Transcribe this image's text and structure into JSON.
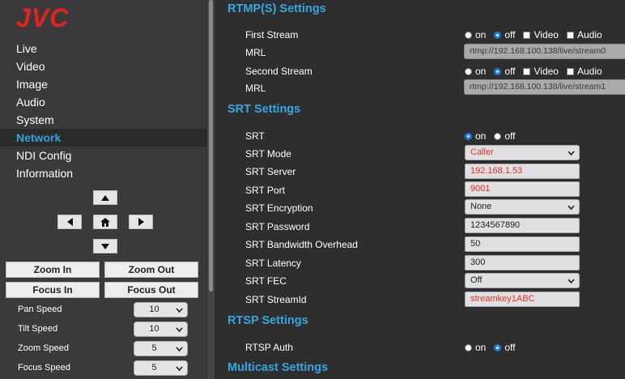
{
  "brand": {
    "logo_text": "JVC",
    "logo_color": "#e2231a"
  },
  "nav": {
    "items": [
      {
        "label": "Live"
      },
      {
        "label": "Video"
      },
      {
        "label": "Image"
      },
      {
        "label": "Audio"
      },
      {
        "label": "System"
      },
      {
        "label": "Network",
        "active": true
      },
      {
        "label": "NDI Config"
      },
      {
        "label": "Information"
      }
    ]
  },
  "ptz": {
    "icons": [
      "arrow-up-icon",
      "arrow-left-icon",
      "home-icon",
      "arrow-right-icon",
      "arrow-down-icon"
    ],
    "zoom_in": "Zoom In",
    "zoom_out": "Zoom Out",
    "focus_in": "Focus In",
    "focus_out": "Focus Out",
    "speeds": [
      {
        "label": "Pan Speed",
        "value": "10"
      },
      {
        "label": "Tilt Speed",
        "value": "10"
      },
      {
        "label": "Zoom Speed",
        "value": "5"
      },
      {
        "label": "Focus Speed",
        "value": "5"
      }
    ]
  },
  "rtmp": {
    "title": "RTMP(S) Settings",
    "first_stream_label": "First Stream",
    "first_stream_state": "off",
    "mrl_label": "MRL",
    "first_mrl": "rtmp://192.168.100.138/live/stream0",
    "second_stream_label": "Second Stream",
    "second_stream_state": "off",
    "second_mrl": "rtmp://192.168.100.138/live/stream1",
    "on": "on",
    "off": "off",
    "video": "Video",
    "audio": "Audio"
  },
  "srt": {
    "title": "SRT Settings",
    "srt_label": "SRT",
    "srt_state": "on",
    "mode_label": "SRT Mode",
    "mode_value": "Caller",
    "server_label": "SRT Server",
    "server_value": "192.168.1.53",
    "port_label": "SRT Port",
    "port_value": "9001",
    "encryption_label": "SRT Encryption",
    "encryption_value": "None",
    "password_label": "SRT Password",
    "password_value": "1234567890",
    "bandwidth_label": "SRT Bandwidth Overhead",
    "bandwidth_value": "50",
    "latency_label": "SRT Latency",
    "latency_value": "300",
    "fec_label": "SRT FEC",
    "fec_value": "Off",
    "streamid_label": "SRT StreamId",
    "streamid_value": "streamkey1ABC"
  },
  "rtsp": {
    "title": "RTSP Settings",
    "auth_label": "RTSP Auth",
    "auth_state": "off"
  },
  "multicast": {
    "title": "Multicast Settings"
  },
  "colors": {
    "accent": "#35a6e2",
    "sidebar_bg": "#3a3a3a",
    "content_bg": "#2e2e2e",
    "highlight_text": "#e0302a",
    "radio_selected": "#1a7ae8"
  }
}
